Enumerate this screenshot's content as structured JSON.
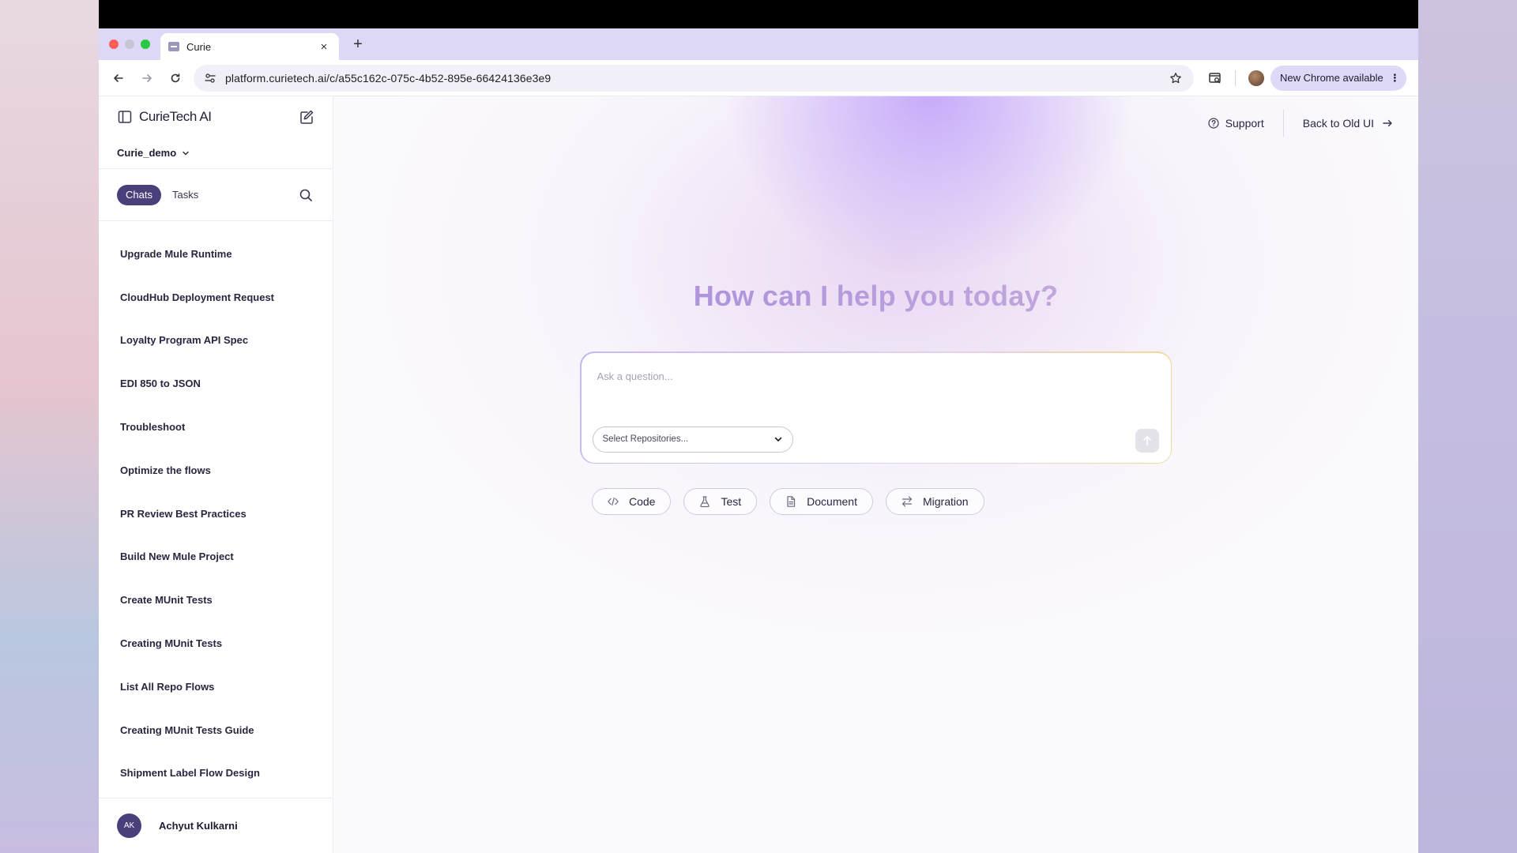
{
  "browser": {
    "tab_title": "Curie",
    "tab_close": "×",
    "new_tab": "+",
    "url": "platform.curietech.ai/c/a55c162c-075c-4b52-895e-66424136e3e9",
    "update_label": "New Chrome available",
    "update_menu": "⋮"
  },
  "sidebar": {
    "brand": "CurieTech AI",
    "workspace": "Curie_demo",
    "tabs": {
      "chats": "Chats",
      "tasks": "Tasks"
    },
    "chats": [
      "Upgrade Mule Runtime",
      "CloudHub Deployment Request",
      "Loyalty Program API Spec",
      "EDI 850 to JSON",
      "Troubleshoot",
      "Optimize the flows",
      "PR Review Best Practices",
      "Build New Mule Project",
      "Create MUnit Tests",
      "Creating MUnit Tests",
      "List All Repo Flows",
      "Creating MUnit Tests Guide",
      "Shipment Label Flow Design"
    ],
    "user": {
      "initials": "AK",
      "name": "Achyut Kulkarni"
    }
  },
  "main": {
    "support": "Support",
    "back_old_ui": "Back to Old UI",
    "headline": "How can I help you today?",
    "input_placeholder": "Ask a question...",
    "repo_select": "Select Repositories...",
    "chips": [
      {
        "label": "Code",
        "icon": "code-icon"
      },
      {
        "label": "Test",
        "icon": "flask-icon"
      },
      {
        "label": "Document",
        "icon": "document-icon"
      },
      {
        "label": "Migration",
        "icon": "swap-icon"
      }
    ]
  },
  "colors": {
    "accent": "#4b3f7b",
    "headline": "#b8a0de",
    "tabstrip": "#dcd8f5"
  }
}
